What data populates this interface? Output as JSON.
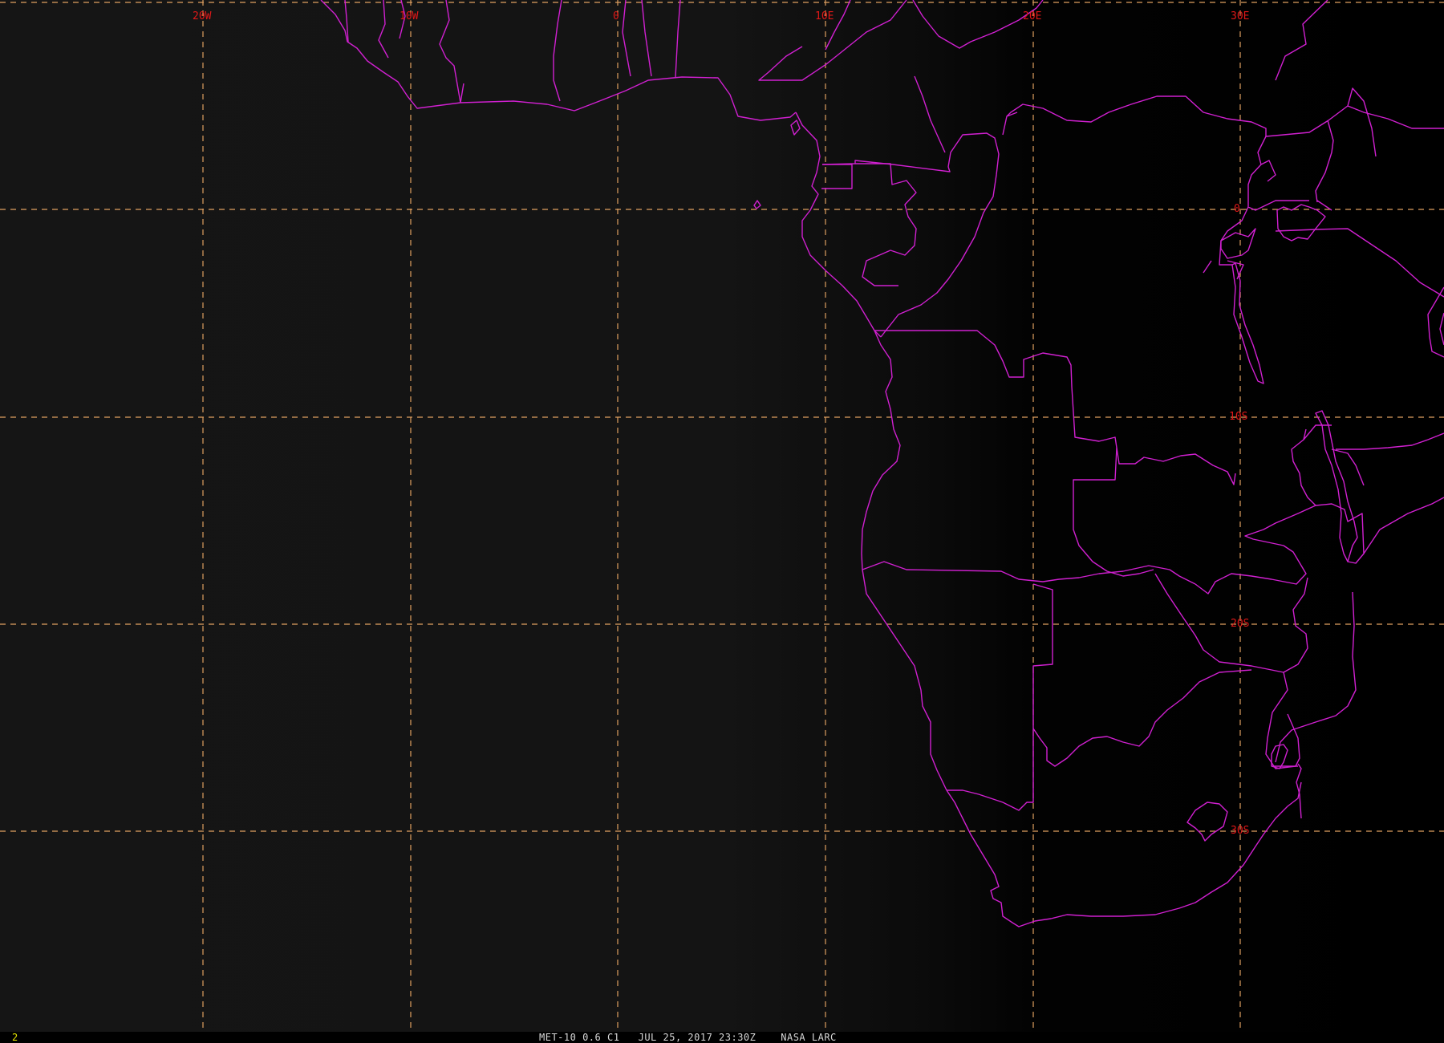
{
  "image": {
    "satellite": "MET-10",
    "band": "0.6",
    "channel": "C1",
    "date": "JUL 25, 2017",
    "time": "23:30Z",
    "source": "NASA LARC",
    "caption": "MET-10 0.6 C1   JUL 25, 2017 23:30Z    NASA LARC",
    "frame_number": "2"
  },
  "grid": {
    "longitude_labels": [
      "20W",
      "10W",
      "0",
      "10E",
      "20E",
      "30E"
    ],
    "latitude_labels": [
      "0",
      "10S",
      "20S",
      "30S"
    ]
  },
  "colors": {
    "background": "#000000",
    "ocean_haze": "#141414",
    "borders": "#d020d0",
    "grid_lines": "#e0a060",
    "grid_labels": "#e01818",
    "caption_text": "#d8d8d8",
    "frame_number": "#e6e600"
  }
}
